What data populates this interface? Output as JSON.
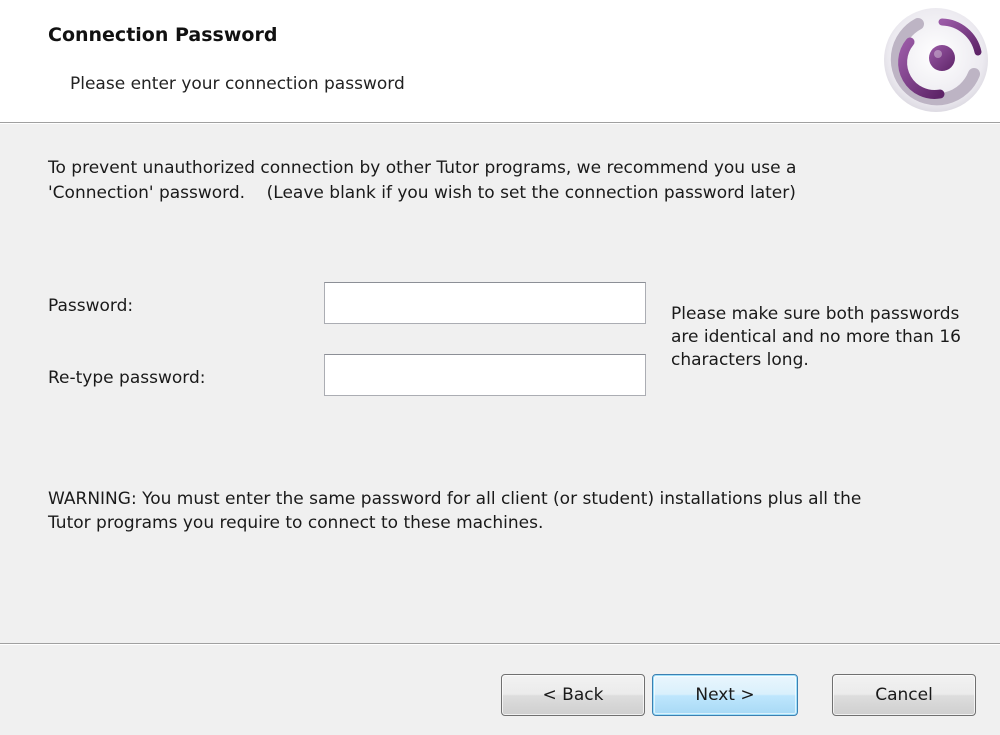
{
  "header": {
    "title": "Connection Password",
    "subtitle": "Please enter your connection password",
    "logo_icon": "purple-ring-logo-icon"
  },
  "intro_text": "To prevent unauthorized connection by other Tutor programs, we recommend you use a\n'Connection' password.    (Leave blank if you wish to set the connection password later)",
  "form": {
    "password_label": "Password:",
    "password_value": "",
    "retype_label": "Re-type password:",
    "retype_value": "",
    "hint": "Please make sure both passwords are identical and no more than 16 characters long."
  },
  "warning_text": "WARNING: You must enter the same password for all client (or student) installations plus all the\nTutor programs you require to connect to these machines.",
  "buttons": {
    "back": "< Back",
    "next": "Next >",
    "cancel": "Cancel"
  },
  "colors": {
    "logo_purple": "#7a3a86",
    "background": "#f0f0f0",
    "default_button_border": "#3c7fb1"
  }
}
